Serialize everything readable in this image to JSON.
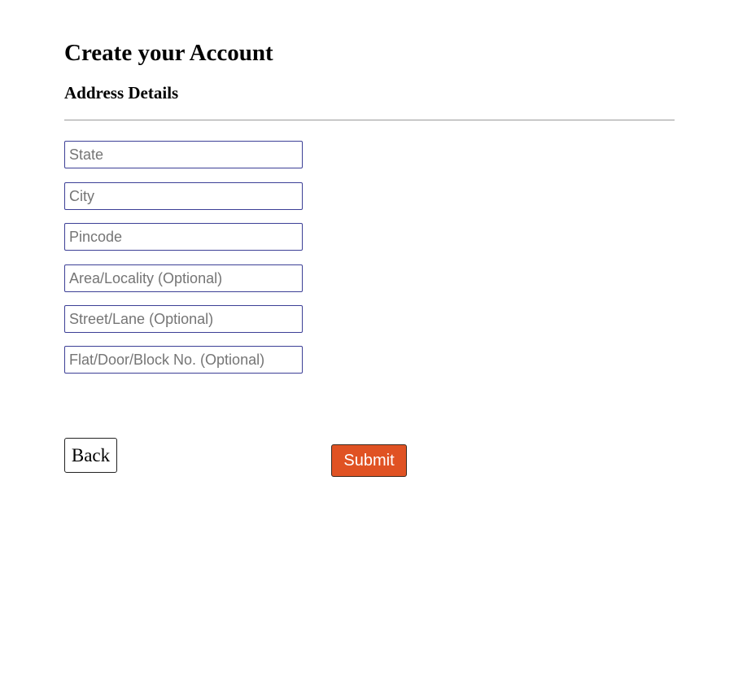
{
  "header": {
    "title": "Create your Account",
    "subtitle": "Address Details"
  },
  "form": {
    "fields": [
      {
        "placeholder": "State",
        "value": ""
      },
      {
        "placeholder": "City",
        "value": ""
      },
      {
        "placeholder": "Pincode",
        "value": ""
      },
      {
        "placeholder": "Area/Locality (Optional)",
        "value": ""
      },
      {
        "placeholder": "Street/Lane (Optional)",
        "value": ""
      },
      {
        "placeholder": "Flat/Door/Block No. (Optional)",
        "value": ""
      }
    ],
    "back_label": "Back",
    "submit_label": "Submit"
  },
  "colors": {
    "submit_bg": "#e05223",
    "field_border": "#3c3f96",
    "divider": "#9a9a9a"
  }
}
